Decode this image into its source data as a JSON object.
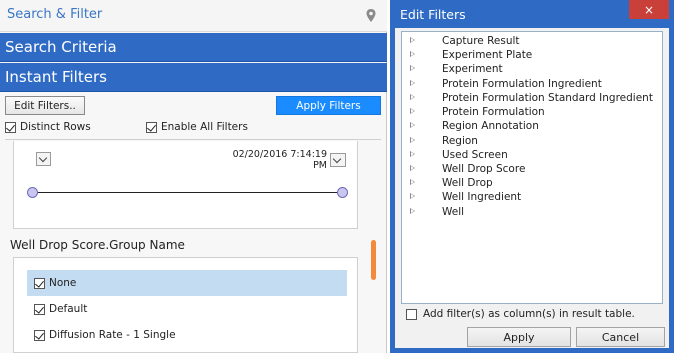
{
  "left_panel": {
    "title": "Search & Filter",
    "search_criteria_label": "Search Criteria",
    "instant_filters_label": "Instant Filters",
    "edit_filters_label": "Edit Filters..",
    "apply_filters_label": "Apply Filters",
    "distinct_rows_label": "Distinct Rows",
    "distinct_rows_checked": true,
    "enable_all_label": "Enable All Filters",
    "enable_all_checked": true,
    "date_range": {
      "end_value": "02/20/2016 7:14:19 PM"
    },
    "group_filter": {
      "title": "Well Drop Score.Group Name",
      "items": [
        {
          "label": "None",
          "checked": true,
          "selected": true
        },
        {
          "label": "Default",
          "checked": true,
          "selected": false
        },
        {
          "label": "Diffusion Rate - 1 Single",
          "checked": true,
          "selected": false
        }
      ]
    },
    "scrollbar_color": "#f28a3a",
    "band_color": "#2f6bc5"
  },
  "dialog": {
    "title": "Edit Filters",
    "close_glyph": "×",
    "tree_items": [
      "Capture Result",
      "Experiment Plate",
      "Experiment",
      "Protein Formulation Ingredient",
      "Protein Formulation Standard Ingredient",
      "Protein Formulation",
      "Region Annotation",
      "Region",
      "Used Screen",
      "Well Drop Score",
      "Well Drop",
      "Well Ingredient",
      "Well"
    ],
    "add_as_columns_label": "Add filter(s) as column(s) in result table.",
    "add_as_columns_checked": false,
    "apply_label": "Apply",
    "cancel_label": "Cancel",
    "close_color": "#c9403a"
  }
}
